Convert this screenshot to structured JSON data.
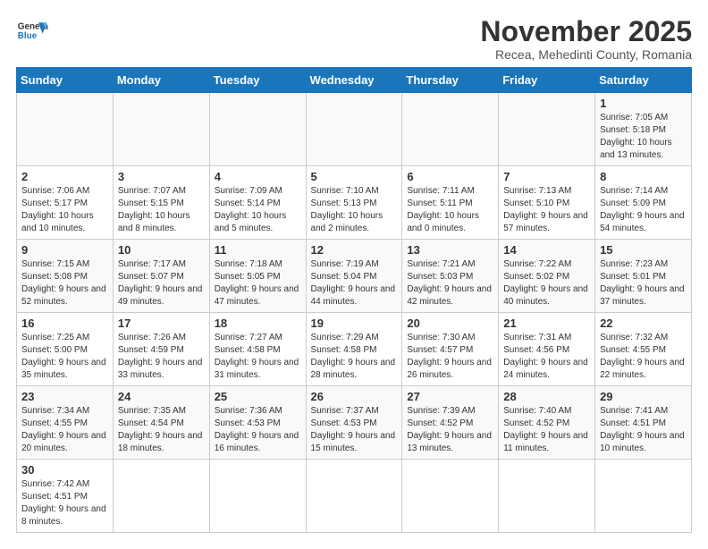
{
  "header": {
    "logo_general": "General",
    "logo_blue": "Blue",
    "title": "November 2025",
    "subtitle": "Recea, Mehedinti County, Romania"
  },
  "days_of_week": [
    "Sunday",
    "Monday",
    "Tuesday",
    "Wednesday",
    "Thursday",
    "Friday",
    "Saturday"
  ],
  "weeks": [
    [
      {
        "day": "",
        "info": ""
      },
      {
        "day": "",
        "info": ""
      },
      {
        "day": "",
        "info": ""
      },
      {
        "day": "",
        "info": ""
      },
      {
        "day": "",
        "info": ""
      },
      {
        "day": "",
        "info": ""
      },
      {
        "day": "1",
        "info": "Sunrise: 7:05 AM\nSunset: 5:18 PM\nDaylight: 10 hours and 13 minutes."
      }
    ],
    [
      {
        "day": "2",
        "info": "Sunrise: 7:06 AM\nSunset: 5:17 PM\nDaylight: 10 hours and 10 minutes."
      },
      {
        "day": "3",
        "info": "Sunrise: 7:07 AM\nSunset: 5:15 PM\nDaylight: 10 hours and 8 minutes."
      },
      {
        "day": "4",
        "info": "Sunrise: 7:09 AM\nSunset: 5:14 PM\nDaylight: 10 hours and 5 minutes."
      },
      {
        "day": "5",
        "info": "Sunrise: 7:10 AM\nSunset: 5:13 PM\nDaylight: 10 hours and 2 minutes."
      },
      {
        "day": "6",
        "info": "Sunrise: 7:11 AM\nSunset: 5:11 PM\nDaylight: 10 hours and 0 minutes."
      },
      {
        "day": "7",
        "info": "Sunrise: 7:13 AM\nSunset: 5:10 PM\nDaylight: 9 hours and 57 minutes."
      },
      {
        "day": "8",
        "info": "Sunrise: 7:14 AM\nSunset: 5:09 PM\nDaylight: 9 hours and 54 minutes."
      }
    ],
    [
      {
        "day": "9",
        "info": "Sunrise: 7:15 AM\nSunset: 5:08 PM\nDaylight: 9 hours and 52 minutes."
      },
      {
        "day": "10",
        "info": "Sunrise: 7:17 AM\nSunset: 5:07 PM\nDaylight: 9 hours and 49 minutes."
      },
      {
        "day": "11",
        "info": "Sunrise: 7:18 AM\nSunset: 5:05 PM\nDaylight: 9 hours and 47 minutes."
      },
      {
        "day": "12",
        "info": "Sunrise: 7:19 AM\nSunset: 5:04 PM\nDaylight: 9 hours and 44 minutes."
      },
      {
        "day": "13",
        "info": "Sunrise: 7:21 AM\nSunset: 5:03 PM\nDaylight: 9 hours and 42 minutes."
      },
      {
        "day": "14",
        "info": "Sunrise: 7:22 AM\nSunset: 5:02 PM\nDaylight: 9 hours and 40 minutes."
      },
      {
        "day": "15",
        "info": "Sunrise: 7:23 AM\nSunset: 5:01 PM\nDaylight: 9 hours and 37 minutes."
      }
    ],
    [
      {
        "day": "16",
        "info": "Sunrise: 7:25 AM\nSunset: 5:00 PM\nDaylight: 9 hours and 35 minutes."
      },
      {
        "day": "17",
        "info": "Sunrise: 7:26 AM\nSunset: 4:59 PM\nDaylight: 9 hours and 33 minutes."
      },
      {
        "day": "18",
        "info": "Sunrise: 7:27 AM\nSunset: 4:58 PM\nDaylight: 9 hours and 31 minutes."
      },
      {
        "day": "19",
        "info": "Sunrise: 7:29 AM\nSunset: 4:58 PM\nDaylight: 9 hours and 28 minutes."
      },
      {
        "day": "20",
        "info": "Sunrise: 7:30 AM\nSunset: 4:57 PM\nDaylight: 9 hours and 26 minutes."
      },
      {
        "day": "21",
        "info": "Sunrise: 7:31 AM\nSunset: 4:56 PM\nDaylight: 9 hours and 24 minutes."
      },
      {
        "day": "22",
        "info": "Sunrise: 7:32 AM\nSunset: 4:55 PM\nDaylight: 9 hours and 22 minutes."
      }
    ],
    [
      {
        "day": "23",
        "info": "Sunrise: 7:34 AM\nSunset: 4:55 PM\nDaylight: 9 hours and 20 minutes."
      },
      {
        "day": "24",
        "info": "Sunrise: 7:35 AM\nSunset: 4:54 PM\nDaylight: 9 hours and 18 minutes."
      },
      {
        "day": "25",
        "info": "Sunrise: 7:36 AM\nSunset: 4:53 PM\nDaylight: 9 hours and 16 minutes."
      },
      {
        "day": "26",
        "info": "Sunrise: 7:37 AM\nSunset: 4:53 PM\nDaylight: 9 hours and 15 minutes."
      },
      {
        "day": "27",
        "info": "Sunrise: 7:39 AM\nSunset: 4:52 PM\nDaylight: 9 hours and 13 minutes."
      },
      {
        "day": "28",
        "info": "Sunrise: 7:40 AM\nSunset: 4:52 PM\nDaylight: 9 hours and 11 minutes."
      },
      {
        "day": "29",
        "info": "Sunrise: 7:41 AM\nSunset: 4:51 PM\nDaylight: 9 hours and 10 minutes."
      }
    ],
    [
      {
        "day": "30",
        "info": "Sunrise: 7:42 AM\nSunset: 4:51 PM\nDaylight: 9 hours and 8 minutes."
      },
      {
        "day": "",
        "info": ""
      },
      {
        "day": "",
        "info": ""
      },
      {
        "day": "",
        "info": ""
      },
      {
        "day": "",
        "info": ""
      },
      {
        "day": "",
        "info": ""
      },
      {
        "day": "",
        "info": ""
      }
    ]
  ]
}
